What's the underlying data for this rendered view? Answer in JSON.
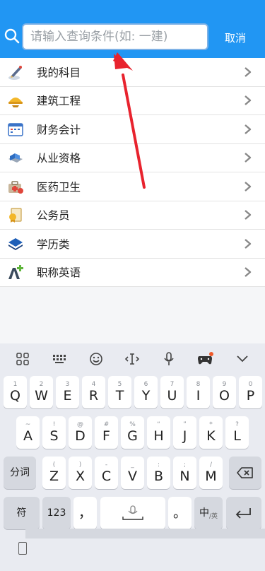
{
  "search": {
    "placeholder": "请输入查询条件(如: 一建)",
    "cancel_label": "取消"
  },
  "categories": [
    {
      "label": "我的科目",
      "icon": "pen-icon"
    },
    {
      "label": "建筑工程",
      "icon": "hardhat-icon"
    },
    {
      "label": "财务会计",
      "icon": "calendar-icon"
    },
    {
      "label": "从业资格",
      "icon": "cube-icon"
    },
    {
      "label": "医药卫生",
      "icon": "medkit-icon"
    },
    {
      "label": "公务员",
      "icon": "certificate-icon"
    },
    {
      "label": "学历类",
      "icon": "layers-icon"
    },
    {
      "label": "职称英语",
      "icon": "letter-a-plus-icon"
    }
  ],
  "keyboard": {
    "row1": [
      {
        "sub": "1",
        "main": "Q"
      },
      {
        "sub": "2",
        "main": "W"
      },
      {
        "sub": "3",
        "main": "E"
      },
      {
        "sub": "4",
        "main": "R"
      },
      {
        "sub": "5",
        "main": "T"
      },
      {
        "sub": "6",
        "main": "Y"
      },
      {
        "sub": "7",
        "main": "U"
      },
      {
        "sub": "8",
        "main": "I"
      },
      {
        "sub": "9",
        "main": "O"
      },
      {
        "sub": "0",
        "main": "P"
      }
    ],
    "row2": [
      {
        "sub": "~",
        "main": "A"
      },
      {
        "sub": "!",
        "main": "S"
      },
      {
        "sub": "@",
        "main": "D"
      },
      {
        "sub": "#",
        "main": "F"
      },
      {
        "sub": "%",
        "main": "G"
      },
      {
        "sub": "“",
        "main": "H"
      },
      {
        "sub": "”",
        "main": "J"
      },
      {
        "sub": "*",
        "main": "K"
      },
      {
        "sub": "?",
        "main": "L"
      }
    ],
    "row3": [
      {
        "sub": "(",
        "main": "Z"
      },
      {
        "sub": ")",
        "main": "X"
      },
      {
        "sub": "-",
        "main": "C"
      },
      {
        "sub": "_",
        "main": "V"
      },
      {
        "sub": ":",
        "main": "B"
      },
      {
        "sub": ";",
        "main": "N"
      },
      {
        "sub": "/",
        "main": "M"
      }
    ],
    "segment_label": "分词",
    "symbol_label": "符",
    "numbers_label": "123",
    "comma_label": "，",
    "period_label": "。",
    "lang_label": "中",
    "lang_sub_label": "/英"
  }
}
